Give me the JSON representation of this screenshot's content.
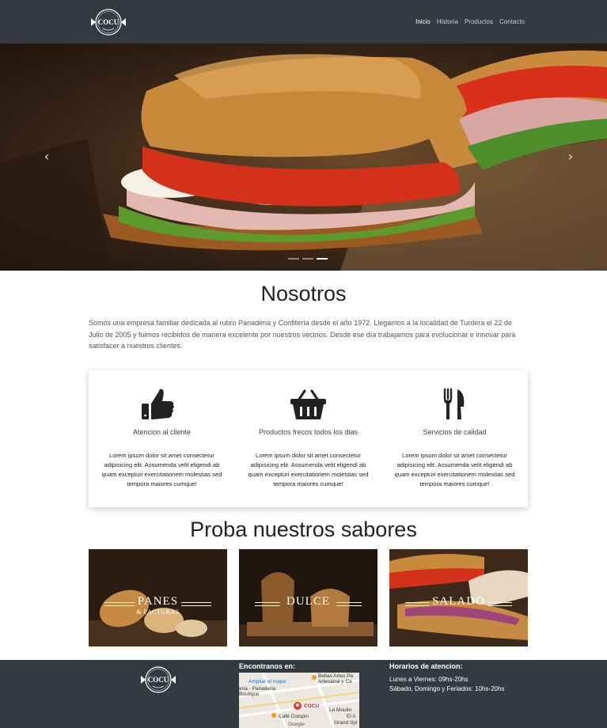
{
  "brand": {
    "logo_text": "COCU"
  },
  "nav": {
    "items": [
      {
        "label": "Inicio",
        "active": true
      },
      {
        "label": "Historia",
        "active": false
      },
      {
        "label": "Productos",
        "active": false
      },
      {
        "label": "Contacto",
        "active": false
      }
    ]
  },
  "carousel": {
    "prev_icon": "chevron-left-icon",
    "next_icon": "chevron-right-icon",
    "slides": 3,
    "active_slide": 3
  },
  "about": {
    "title": "Nosotros",
    "text": "Somos una empresa familiar dedicada al rubro Panaderia y Confitería desde el año 1972. Llegamos a la localidad de Turdera el 22 de Julio de 2005 y fuimos recibidos de manera excelente por nuestros vecinos. Desde ese día trabajamos para evolucionar e innovar para satisfacer a nuestros clientes."
  },
  "features": [
    {
      "icon": "thumbs-up-icon",
      "title": "Atencion al cliente",
      "text": "Lorem ipsum dolor sit amet consectetur adipisicing elit. Assumenda velit eligendi ab quam excepturi exercitationem molestias sed tempora maiores cumque!"
    },
    {
      "icon": "shopping-basket-icon",
      "title": "Productos frecos todos los dias",
      "text": "Lorem ipsum dolor sit amet consectetur adipisicing elit. Assumenda velit eligendi ab quam excepturi exercitationem molestias sed tempora maiores cumque!"
    },
    {
      "icon": "utensils-icon",
      "title": "Servicios de calidad",
      "text": "Lorem ipsum dolor sit amet consectetur adipisicing elit. Assumenda velit eligendi ab quam excepturi exercitationem molestias sed tempora maiores cumque!"
    }
  ],
  "sabores": {
    "title": "Proba nuestros sabores",
    "tiles": [
      {
        "label": "PANES",
        "sublabel": "& FACTURAS"
      },
      {
        "label": "DULCE",
        "sublabel": ""
      },
      {
        "label": "SALADO",
        "sublabel": ""
      }
    ]
  },
  "footer": {
    "logo_text": "COCU",
    "map_heading": "Encontranos en:",
    "map": {
      "link": "Ampliar el mapa",
      "places": [
        "Bellas Artes Pa",
        "Artesanal y Ca",
        "ena - Panaderia",
        "Boutique",
        "COCU",
        "Le Moulin",
        "Café Crespin",
        "El A",
        "Grand Spl"
      ],
      "provider": "Google"
    },
    "hours_heading": "Horarios de atencion:",
    "hours": [
      "Lunes a Viernes: 09hs-20hs",
      "Sábado, Domingo y Feriados: 10hs-20hs"
    ]
  },
  "colors": {
    "navbar": "#343a40",
    "footer": "#343a40",
    "text": "#222222"
  }
}
